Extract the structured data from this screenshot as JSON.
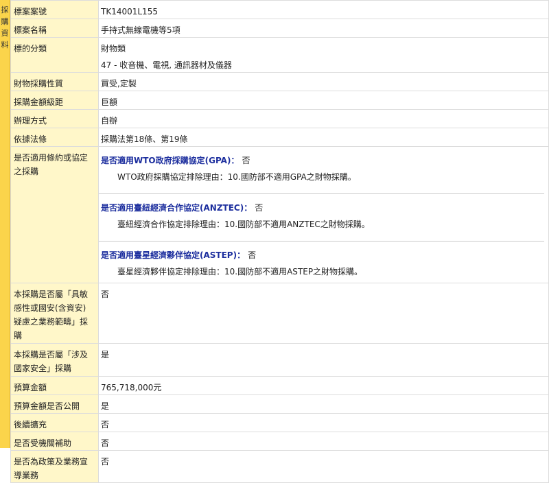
{
  "side_label": "採購資料",
  "rows": {
    "case_no": {
      "label": "標案案號",
      "value": "TK14001L155"
    },
    "case_name": {
      "label": "標案名稱",
      "value": "手持式無線電機等5項"
    },
    "category": {
      "label": "標的分類",
      "value1": "財物類",
      "value2": "47 - 收音機、電視, 通訊器材及儀器"
    },
    "nature": {
      "label": "財物採購性質",
      "value": "買受,定製"
    },
    "amount_level": {
      "label": "採購金額級距",
      "value": "巨額"
    },
    "method": {
      "label": "辦理方式",
      "value": "自辦"
    },
    "law": {
      "label": "依據法條",
      "value": "採購法第18條、第19條"
    },
    "agreement": {
      "label": "是否適用條約或協定之採購",
      "items": [
        {
          "head": "是否適用WTO政府採購協定(GPA)：",
          "answer": "否",
          "reason": "WTO政府採購協定排除理由：10.國防部不適用GPA之財物採購。"
        },
        {
          "head": "是否適用臺紐經濟合作協定(ANZTEC)：",
          "answer": "否",
          "reason": "臺紐經濟合作協定排除理由：10.國防部不適用ANZTEC之財物採購。"
        },
        {
          "head": "是否適用臺星經濟夥伴協定(ASTEP)：",
          "answer": "否",
          "reason": "臺星經濟夥伴協定排除理由：10.國防部不適用ASTEP之財物採購。"
        }
      ]
    },
    "sensitive": {
      "label": "本採購是否屬「具敏感性或國安(含資安)疑慮之業務範疇」採購",
      "value": "否"
    },
    "security": {
      "label": "本採購是否屬「涉及國家安全」採購",
      "value": "是"
    },
    "budget": {
      "label": "預算金額",
      "value": "765,718,000元"
    },
    "budget_public": {
      "label": "預算金額是否公開",
      "value": "是"
    },
    "expansion": {
      "label": "後續擴充",
      "value": "否"
    },
    "subsidy": {
      "label": "是否受機關補助",
      "value": "否"
    },
    "policy": {
      "label": "是否為政策及業務宣導業務",
      "value": "否"
    }
  }
}
